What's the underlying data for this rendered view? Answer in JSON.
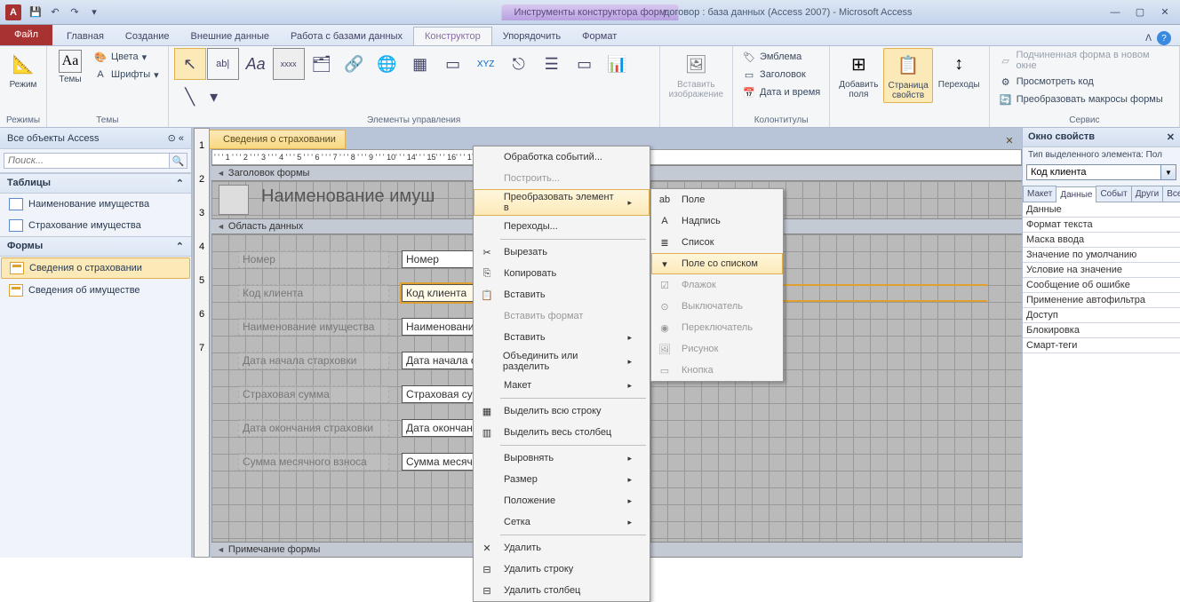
{
  "title_tool": "Инструменты конструктора форм",
  "title_right": "договор : база данных (Access 2007)  -  Microsoft Access",
  "tabs": {
    "file": "Файл",
    "items": [
      "Главная",
      "Создание",
      "Внешние данные",
      "Работа с базами данных",
      "Конструктор",
      "Упорядочить",
      "Формат"
    ],
    "active_index": 4
  },
  "ribbon": {
    "g_modes": {
      "label": "Режимы",
      "view": "Режим"
    },
    "g_themes": {
      "label": "Темы",
      "themes": "Темы",
      "colors": "Цвета",
      "fonts": "Шрифты"
    },
    "g_controls": {
      "label": "Элементы управления"
    },
    "g_image": {
      "label": "",
      "insert_img": "Вставить\nизображение"
    },
    "g_header": {
      "label": "Колонтитулы",
      "emblem": "Эмблема",
      "title": "Заголовок",
      "datetime": "Дата и время"
    },
    "g_tools": {
      "label": "",
      "addfields": "Добавить\nполя",
      "propsheet": "Страница\nсвойств",
      "taborder": "Переходы"
    },
    "g_service": {
      "label": "Сервис",
      "subform": "Подчиненная форма в новом окне",
      "viewcode": "Просмотреть код",
      "convmacro": "Преобразовать макросы формы"
    }
  },
  "nav": {
    "header": "Все объекты Access",
    "search_ph": "Поиск...",
    "groups": [
      {
        "label": "Таблицы",
        "items": [
          "Наименование имущества",
          "Страхование имущества"
        ]
      },
      {
        "label": "Формы",
        "items": [
          "Сведения о страховании",
          "Сведения об имуществе"
        ],
        "sel_index": 0
      }
    ]
  },
  "doc": {
    "tab": "Сведения о страховании",
    "ruler_text": "' ' ' 1 ' ' ' 2 ' ' ' 3 ' ' ' 4 ' ' ' 5 ' ' ' 6 ' ' ' 7 ' ' ' 8 ' ' ' 9 ' ' ' 10'                                                                        ' ' 14' ' ' 15' ' ' 16' ' ' 17' ' ' 18' ' ' 19' ' ' 20' ' ' 21' ' ' 22' ' ' 23'",
    "sec_header": "Заголовок формы",
    "sec_detail": "Область данных",
    "sec_footer": "Примечание формы",
    "header_label": "Наименование имуш",
    "rows": [
      {
        "label": "Номер",
        "ctrl": "Номер"
      },
      {
        "label": "Код клиента",
        "ctrl": "Код клиента",
        "sel": true
      },
      {
        "label": "Наименование имущества",
        "ctrl": "Наименование"
      },
      {
        "label": "Дата начала старховки",
        "ctrl": "Дата начала с"
      },
      {
        "label": "Страховая сумма",
        "ctrl": "Страховая су"
      },
      {
        "label": "Дата окончания страховки",
        "ctrl": "Дата окончан"
      },
      {
        "label": "Сумма месячного взноса",
        "ctrl": "Сумма месяч"
      }
    ]
  },
  "ctx1": [
    {
      "t": "Обработка событий...",
      "u": "б"
    },
    {
      "t": "Построить...",
      "u": "о",
      "dis": true
    },
    {
      "t": "Преобразовать элемент в",
      "u": "",
      "sub": true,
      "hover": true
    },
    {
      "t": "Переходы...",
      "u": "е"
    },
    {
      "sep": true
    },
    {
      "t": "Вырезать",
      "u": "",
      "ic": "✂"
    },
    {
      "t": "Копировать",
      "u": "К",
      "ic": "⎘"
    },
    {
      "t": "Вставить",
      "u": "В",
      "ic": "📋"
    },
    {
      "t": "Вставить формат",
      "u": "",
      "dis": true
    },
    {
      "t": "Вставить",
      "u": "т",
      "sub": true
    },
    {
      "t": "Объединить или разделить",
      "u": "б",
      "sub": true
    },
    {
      "t": "Макет",
      "u": "М",
      "sub": true
    },
    {
      "sep": true
    },
    {
      "t": "Выделить всю строку",
      "u": "",
      "ic": "▦"
    },
    {
      "t": "Выделить весь столбец",
      "u": "б",
      "ic": "▥"
    },
    {
      "sep": true
    },
    {
      "t": "Выровнять",
      "u": "ы",
      "sub": true
    },
    {
      "t": "Размер",
      "u": "Р",
      "sub": true
    },
    {
      "t": "Положение",
      "u": "П",
      "sub": true
    },
    {
      "t": "Сетка",
      "u": "С",
      "sub": true
    },
    {
      "sep": true
    },
    {
      "t": "Удалить",
      "u": "У",
      "ic": "✕"
    },
    {
      "t": "Удалить строку",
      "u": "",
      "ic": "⊟"
    },
    {
      "t": "Удалить столбец",
      "u": "б",
      "ic": "⊟"
    }
  ],
  "ctx2": [
    {
      "t": "Поле",
      "ic": "ab"
    },
    {
      "t": "Надпись",
      "ic": "A"
    },
    {
      "t": "Список",
      "ic": "≣"
    },
    {
      "t": "Поле со списком",
      "ic": "▾",
      "hover": true
    },
    {
      "t": "Флажок",
      "ic": "☑",
      "dis": true
    },
    {
      "t": "Выключатель",
      "ic": "⊙",
      "dis": true
    },
    {
      "t": "Переключатель",
      "ic": "◉",
      "dis": true
    },
    {
      "t": "Рисунок",
      "ic": "🖼",
      "dis": true
    },
    {
      "t": "Кнопка",
      "ic": "▭",
      "dis": true
    }
  ],
  "props": {
    "title": "Окно свойств",
    "subtitle": "Тип выделенного элемента:  Пол",
    "combo": "Код клиента",
    "tabs": [
      "Макет",
      "Данные",
      "Событ",
      "Други",
      "Все"
    ],
    "active_tab": 1,
    "rows": [
      "Данные",
      "Формат текста",
      "Маска ввода",
      "Значение по умолчанию",
      "Условие на значение",
      "Сообщение об ошибке",
      "Применение автофильтра",
      "Доступ",
      "Блокировка",
      "Смарт-теги"
    ]
  }
}
